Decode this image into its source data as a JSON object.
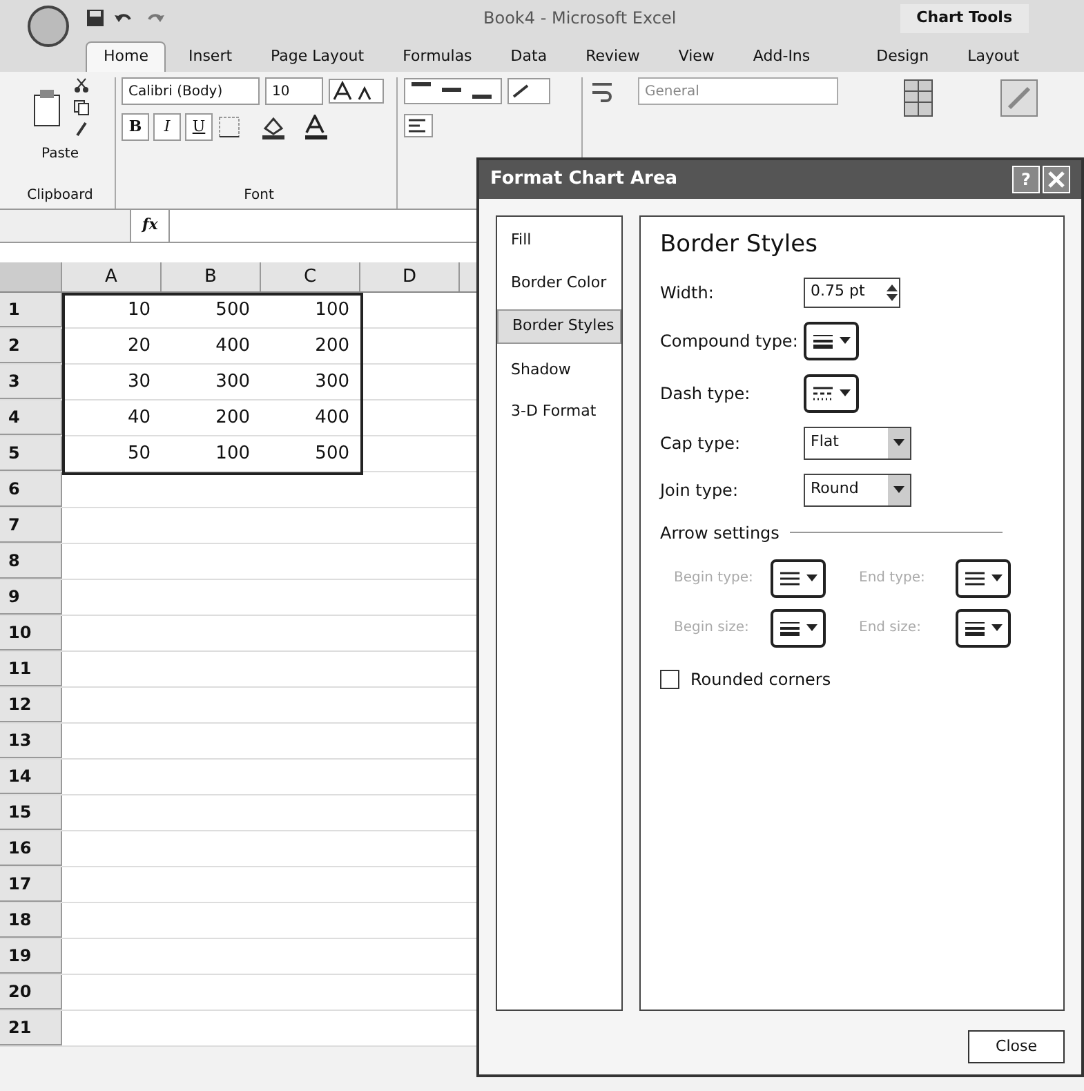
{
  "window": {
    "title": "Book4 - Microsoft Excel",
    "context_tab": "Chart Tools"
  },
  "tabs": [
    {
      "label": "Home",
      "selected": true
    },
    {
      "label": "Insert",
      "selected": false
    },
    {
      "label": "Page Layout",
      "selected": false
    },
    {
      "label": "Formulas",
      "selected": false
    },
    {
      "label": "Data",
      "selected": false
    },
    {
      "label": "Review",
      "selected": false
    },
    {
      "label": "View",
      "selected": false
    },
    {
      "label": "Add-Ins",
      "selected": false
    },
    {
      "label": "Design",
      "selected": false
    },
    {
      "label": "Layout",
      "selected": false
    }
  ],
  "ribbon": {
    "paste_label": "Paste",
    "clipboard_label": "Clipboard",
    "font_name": "Calibri (Body)",
    "font_size": "10",
    "bold": "B",
    "italic": "I",
    "underline": "U",
    "font_group_label": "Font",
    "number_format": "General"
  },
  "formula_bar": {
    "fx": "fx"
  },
  "sheet": {
    "columns": [
      "A",
      "B",
      "C",
      "D"
    ],
    "rows": [
      {
        "label": "1",
        "cells": [
          "10",
          "500",
          "100"
        ]
      },
      {
        "label": "2",
        "cells": [
          "20",
          "400",
          "200"
        ]
      },
      {
        "label": "3",
        "cells": [
          "30",
          "300",
          "300"
        ]
      },
      {
        "label": "4",
        "cells": [
          "40",
          "200",
          "400"
        ]
      },
      {
        "label": "5",
        "cells": [
          "50",
          "100",
          "500"
        ]
      },
      {
        "label": "6",
        "cells": []
      },
      {
        "label": "7",
        "cells": []
      },
      {
        "label": "8",
        "cells": []
      },
      {
        "label": "9",
        "cells": []
      },
      {
        "label": "10",
        "cells": []
      },
      {
        "label": "11",
        "cells": []
      },
      {
        "label": "12",
        "cells": []
      },
      {
        "label": "13",
        "cells": []
      },
      {
        "label": "14",
        "cells": []
      },
      {
        "label": "15",
        "cells": []
      },
      {
        "label": "16",
        "cells": []
      },
      {
        "label": "17",
        "cells": []
      },
      {
        "label": "18",
        "cells": []
      },
      {
        "label": "19",
        "cells": []
      },
      {
        "label": "20",
        "cells": []
      },
      {
        "label": "21",
        "cells": []
      }
    ]
  },
  "dialog": {
    "title": "Format Chart Area",
    "help": "?",
    "nav": [
      {
        "label": "Fill",
        "selected": false
      },
      {
        "label": "Border Color",
        "selected": false
      },
      {
        "label": "Border Styles",
        "selected": true
      },
      {
        "label": "Shadow",
        "selected": false
      },
      {
        "label": "3-D Format",
        "selected": false
      }
    ],
    "heading": "Border Styles",
    "width_label": "Width:",
    "width_value": "0.75 pt",
    "compound_label": "Compound type:",
    "dash_label": "Dash type:",
    "cap_label": "Cap type:",
    "cap_value": "Flat",
    "join_label": "Join type:",
    "join_value": "Round",
    "arrow_section": "Arrow settings",
    "arrows": [
      {
        "label": "Begin type:",
        "disabled": true
      },
      {
        "label": "End type:",
        "disabled": true
      },
      {
        "label": "Begin size:",
        "disabled": true
      },
      {
        "label": "End size:",
        "disabled": true
      }
    ],
    "rounded_corners": {
      "label": "Rounded corners",
      "checked": false
    },
    "close": "Close"
  }
}
